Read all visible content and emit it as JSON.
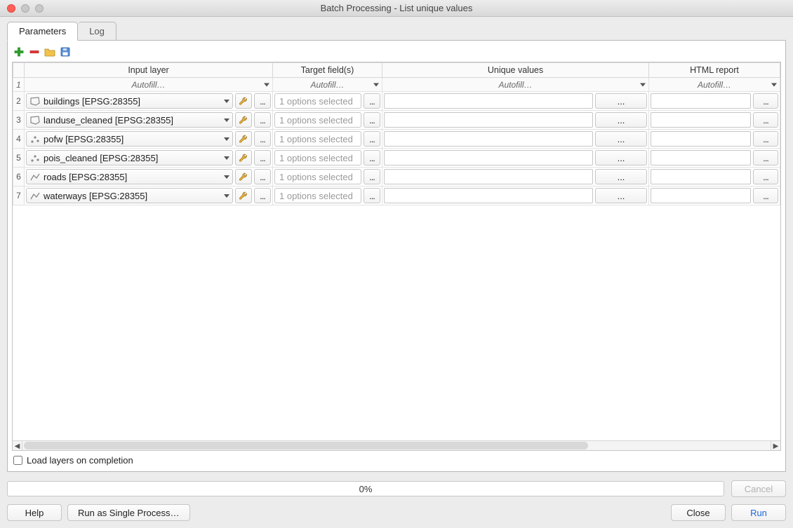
{
  "window": {
    "title": "Batch Processing - List unique values"
  },
  "tabs": {
    "parameters": "Parameters",
    "log": "Log"
  },
  "toolbar": {
    "add": "add-row",
    "remove": "remove-row",
    "open": "open",
    "save": "save"
  },
  "headers": {
    "input_layer": "Input layer",
    "target_fields": "Target field(s)",
    "unique_values": "Unique values",
    "html_report": "HTML report"
  },
  "autofill_label": "Autofill…",
  "rows": [
    {
      "n": "2",
      "layer": "buildings [EPSG:28355]",
      "geom": "polygon",
      "fields": "1 options selected",
      "uv": "",
      "uvbtn": "...",
      "html": ""
    },
    {
      "n": "3",
      "layer": "landuse_cleaned [EPSG:28355]",
      "geom": "polygon",
      "fields": "1 options selected",
      "uv": "",
      "uvbtn": "...",
      "html": ""
    },
    {
      "n": "4",
      "layer": "pofw [EPSG:28355]",
      "geom": "point",
      "fields": "1 options selected",
      "uv": "",
      "uvbtn": "...",
      "html": ""
    },
    {
      "n": "5",
      "layer": "pois_cleaned [EPSG:28355]",
      "geom": "point",
      "fields": "1 options selected",
      "uv": "",
      "uvbtn": "...",
      "html": ""
    },
    {
      "n": "6",
      "layer": "roads [EPSG:28355]",
      "geom": "line",
      "fields": "1 options selected",
      "uv": "",
      "uvbtn": "...",
      "html": ""
    },
    {
      "n": "7",
      "layer": "waterways [EPSG:28355]",
      "geom": "line",
      "fields": "1 options selected",
      "uv": "",
      "uvbtn": "...",
      "html": ""
    }
  ],
  "checkbox": {
    "label": "Load layers on completion",
    "checked": false
  },
  "progress": {
    "text": "0%"
  },
  "buttons": {
    "cancel": "Cancel",
    "help": "Help",
    "run_single": "Run as Single Process…",
    "close": "Close",
    "run": "Run"
  }
}
